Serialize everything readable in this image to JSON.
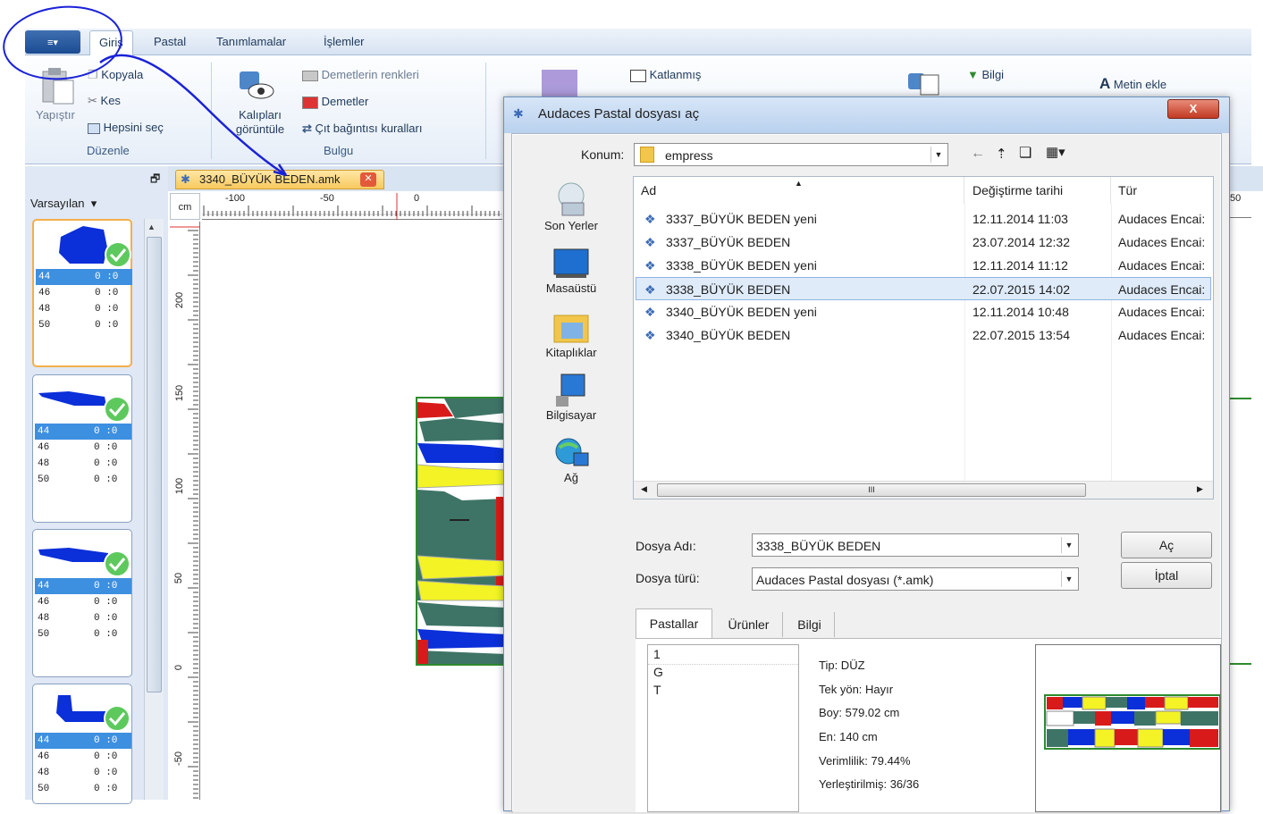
{
  "ribbon": {
    "app_button": "≡▾",
    "tabs": [
      "Giriş",
      "Pastal",
      "Tanımlamalar",
      "İşlemler"
    ],
    "edit": {
      "copy": "Kopyala",
      "cut": "Kes",
      "select_all": "Hepsini seç",
      "paste": "Yapıştır",
      "group": "Düzenle"
    },
    "find": {
      "show_patterns": "Kalıpları görüntüle",
      "bundle_colors": "Demetlerin renkleri",
      "bundles": "Demetler",
      "rules": "Çıt bağıntısı kuralları",
      "group": "Bulgu"
    },
    "folded": "Katlanmış",
    "info": "Bilgi",
    "add_text": "Metin ekle"
  },
  "left_panel": {
    "preset": "Varsayılan",
    "thumbs": [
      {
        "rows": [
          {
            "size": "44",
            "val": "0 :0"
          },
          {
            "size": "46",
            "val": "0 :0"
          },
          {
            "size": "48",
            "val": "0 :0"
          },
          {
            "size": "50",
            "val": "0 :0"
          }
        ]
      },
      {
        "rows": [
          {
            "size": "44",
            "val": "0 :0"
          },
          {
            "size": "46",
            "val": "0 :0"
          },
          {
            "size": "48",
            "val": "0 :0"
          },
          {
            "size": "50",
            "val": "0 :0"
          }
        ]
      },
      {
        "rows": [
          {
            "size": "44",
            "val": "0 :0"
          },
          {
            "size": "46",
            "val": "0 :0"
          },
          {
            "size": "48",
            "val": "0 :0"
          },
          {
            "size": "50",
            "val": "0 :0"
          }
        ]
      },
      {
        "rows": [
          {
            "size": "44",
            "val": "0 :0"
          },
          {
            "size": "46",
            "val": "0 :0"
          },
          {
            "size": "48",
            "val": "0 :0"
          },
          {
            "size": "50",
            "val": "0 :0"
          }
        ]
      }
    ]
  },
  "document": {
    "tab_title": "3340_BÜYÜK BEDEN.amk",
    "unit": "cm",
    "h_ruler": [
      "-100",
      "-50",
      "0",
      "50"
    ],
    "v_ruler": [
      "200",
      "150",
      "100",
      "50",
      "0",
      "-50"
    ]
  },
  "dialog": {
    "title": "Audaces Pastal dosyası aç",
    "close": "X",
    "location_label": "Konum:",
    "location": "empress",
    "places": [
      "Son Yerler",
      "Masaüstü",
      "Kitaplıklar",
      "Bilgisayar",
      "Ağ"
    ],
    "columns": [
      "Ad",
      "Değiştirme tarihi",
      "Tür"
    ],
    "files": [
      {
        "name": "3337_BÜYÜK BEDEN yeni",
        "date": "12.11.2014 11:03",
        "type": "Audaces Encai:"
      },
      {
        "name": "3337_BÜYÜK BEDEN",
        "date": "23.07.2014 12:32",
        "type": "Audaces Encai:"
      },
      {
        "name": "3338_BÜYÜK BEDEN yeni",
        "date": "12.11.2014 11:12",
        "type": "Audaces Encai:"
      },
      {
        "name": "3338_BÜYÜK BEDEN",
        "date": "22.07.2015 14:02",
        "type": "Audaces Encai:"
      },
      {
        "name": "3340_BÜYÜK BEDEN yeni",
        "date": "12.11.2014 10:48",
        "type": "Audaces Encai:"
      },
      {
        "name": "3340_BÜYÜK BEDEN",
        "date": "22.07.2015 13:54",
        "type": "Audaces Encai:"
      }
    ],
    "scroll_mark": "III",
    "filename_label": "Dosya Adı:",
    "filename": "3338_BÜYÜK BEDEN",
    "filetype_label": "Dosya türü:",
    "filetype": "Audaces Pastal dosyası (*.amk)",
    "open": "Aç",
    "cancel": "İptal",
    "tabs": [
      "Pastallar",
      "Ürünler",
      "Bilgi"
    ],
    "markers": [
      "1",
      "G",
      "T"
    ],
    "info": [
      "Tip: DÜZ",
      "Tek yön: Hayır",
      "Boy: 579.02 cm",
      "En: 140 cm",
      "Verimlilik: 79.44%",
      "Yerleştirilmiş: 36/36"
    ]
  },
  "colors": {
    "accent": "#3d8fe0",
    "selection": "#f3b04a",
    "annotation": "#1a22d8",
    "green_border": "#2e8b2e"
  }
}
